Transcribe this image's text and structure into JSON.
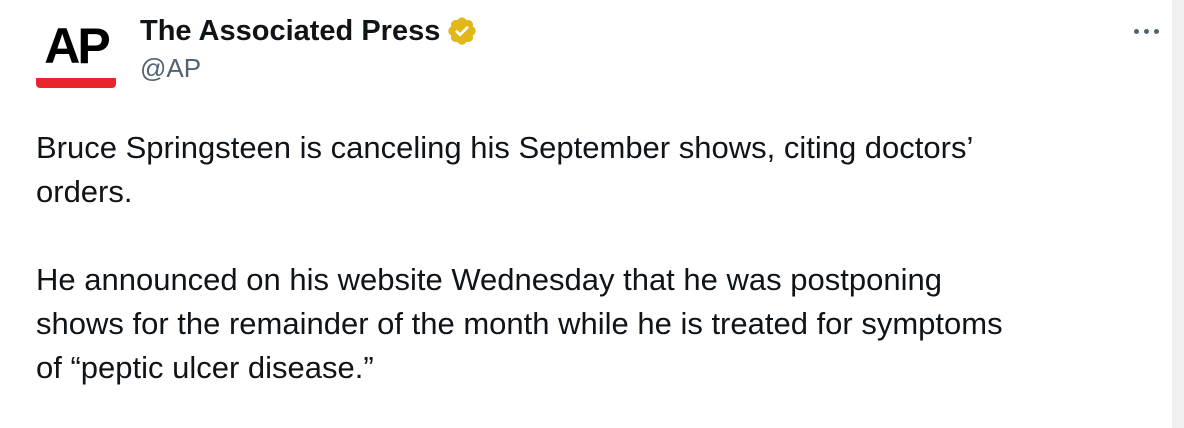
{
  "author": {
    "avatar_text": "AP",
    "display_name": "The Associated Press",
    "handle": "@AP",
    "verified_badge_icon": "verified-gold-badge-icon",
    "avatar_bar_color": "#e8262b",
    "badge_color": "#e2b719"
  },
  "menu": {
    "icon": "more-options-icon"
  },
  "tweet": {
    "paragraph_1_line_1": "Bruce Springsteen is canceling his September shows, citing doctors’",
    "paragraph_1_line_2": "orders.",
    "paragraph_2_line_1": "He announced on his website Wednesday that he was postponing",
    "paragraph_2_line_2": "shows for the remainder of the month while he is treated for symptoms",
    "paragraph_2_line_3": "of “peptic ulcer disease.”"
  }
}
